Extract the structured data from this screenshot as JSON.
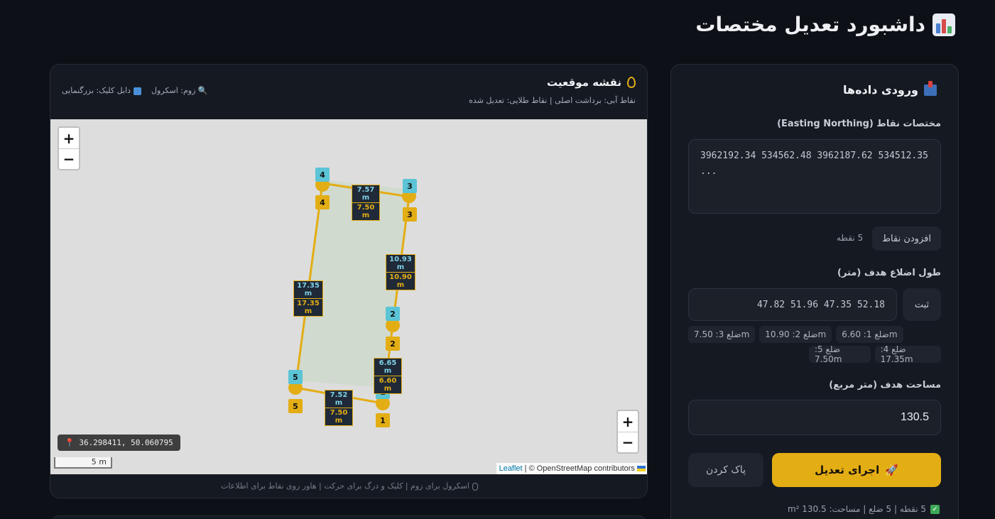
{
  "page": {
    "title": "داشبورد تعدیل مختصات",
    "title_icon": "bar-chart-icon"
  },
  "input_panel": {
    "title": "ورودی داده‌ها",
    "coords_label": "مختصات نقاط (Easting Northing)",
    "coords_value": "3962192.34 534562.48 3962187.62 534512.35\n...",
    "add_points_label": "افزودن نقاط",
    "points_count": "5 نقطه",
    "sides_label": "طول اضلاع هدف (متر)",
    "sides_value": "47.82 51.96 47.35 52.18",
    "save_label": "ثبت",
    "side_chips_row1": [
      "ضلع 1: 6.60m",
      "ضلع 2: 10.90m",
      "ضلع 3: 7.50m"
    ],
    "side_chips_row2": [
      "ضلع 4: 17.35m",
      "ضلع 5: 7.50m"
    ],
    "area_label": "مساحت هدف (متر مربع)",
    "area_value": "130.5",
    "run_label": "اجرای تعدیل",
    "clear_label": "پاک کردن",
    "status_text": "5 نقطه | 5 ضلع | مساحت: 130.5 m²",
    "accent_color": "#e3ad14"
  },
  "map_panel": {
    "title": "نقشه موقعیت",
    "subtitle": "نقاط آبی: برداشت اصلی | نقاط طلایی: تعدیل شده",
    "hint_zoom": "زوم: اسکرول",
    "hint_dblclick": "دابل کلیک: بزرگنمایی",
    "zoom_in": "+",
    "zoom_out": "−",
    "cursor_coords": "📍 36.298411, 50.060795",
    "scale_label": "5 m",
    "attribution_link": "Leaflet",
    "attribution_text": " | © OpenStreetMap contributors",
    "footer": "اسکرول برای زوم | کلیک و درگ برای حرکت | هاور روی نقاط برای اطلاعات",
    "original_color": "#5bc4d6",
    "adjusted_color": "#e3ad14",
    "points": [
      {
        "id": "1",
        "orig_label": "1",
        "adj_label": "1"
      },
      {
        "id": "2",
        "orig_label": "2",
        "adj_label": "2"
      },
      {
        "id": "3",
        "orig_label": "3",
        "adj_label": "3"
      },
      {
        "id": "4",
        "orig_label": "4",
        "adj_label": "4"
      },
      {
        "id": "5",
        "orig_label": "5",
        "adj_label": "5"
      }
    ],
    "edge_labels": [
      {
        "orig": "7.57 m",
        "adj": "7.50 m"
      },
      {
        "orig": "10.93 m",
        "adj": "10.90 m"
      },
      {
        "orig": "17.35 m",
        "adj": "17.35 m"
      },
      {
        "orig": "6.65 m",
        "adj": "6.60 m"
      },
      {
        "orig": "7.52 m",
        "adj": "7.50 m"
      }
    ]
  }
}
